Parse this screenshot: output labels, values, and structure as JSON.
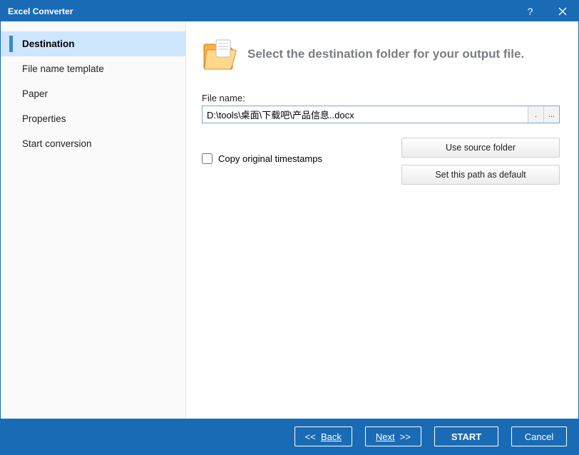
{
  "titlebar": {
    "title": "Excel Converter"
  },
  "sidebar": {
    "items": [
      {
        "label": "Destination"
      },
      {
        "label": "File name template"
      },
      {
        "label": "Paper"
      },
      {
        "label": "Properties"
      },
      {
        "label": "Start conversion"
      }
    ]
  },
  "main": {
    "heading": "Select the destination folder for your output file.",
    "file_label": "File name:",
    "file_value": "D:\\tools\\桌面\\下载吧\\产品信息..docx",
    "dot_btn": ".",
    "browse_btn": "...",
    "copy_ts_label": "Copy original timestamps",
    "use_source": "Use source folder",
    "set_default": "Set this path as default"
  },
  "footer": {
    "back": "Back",
    "next": "Next",
    "start": "START",
    "cancel": "Cancel"
  }
}
